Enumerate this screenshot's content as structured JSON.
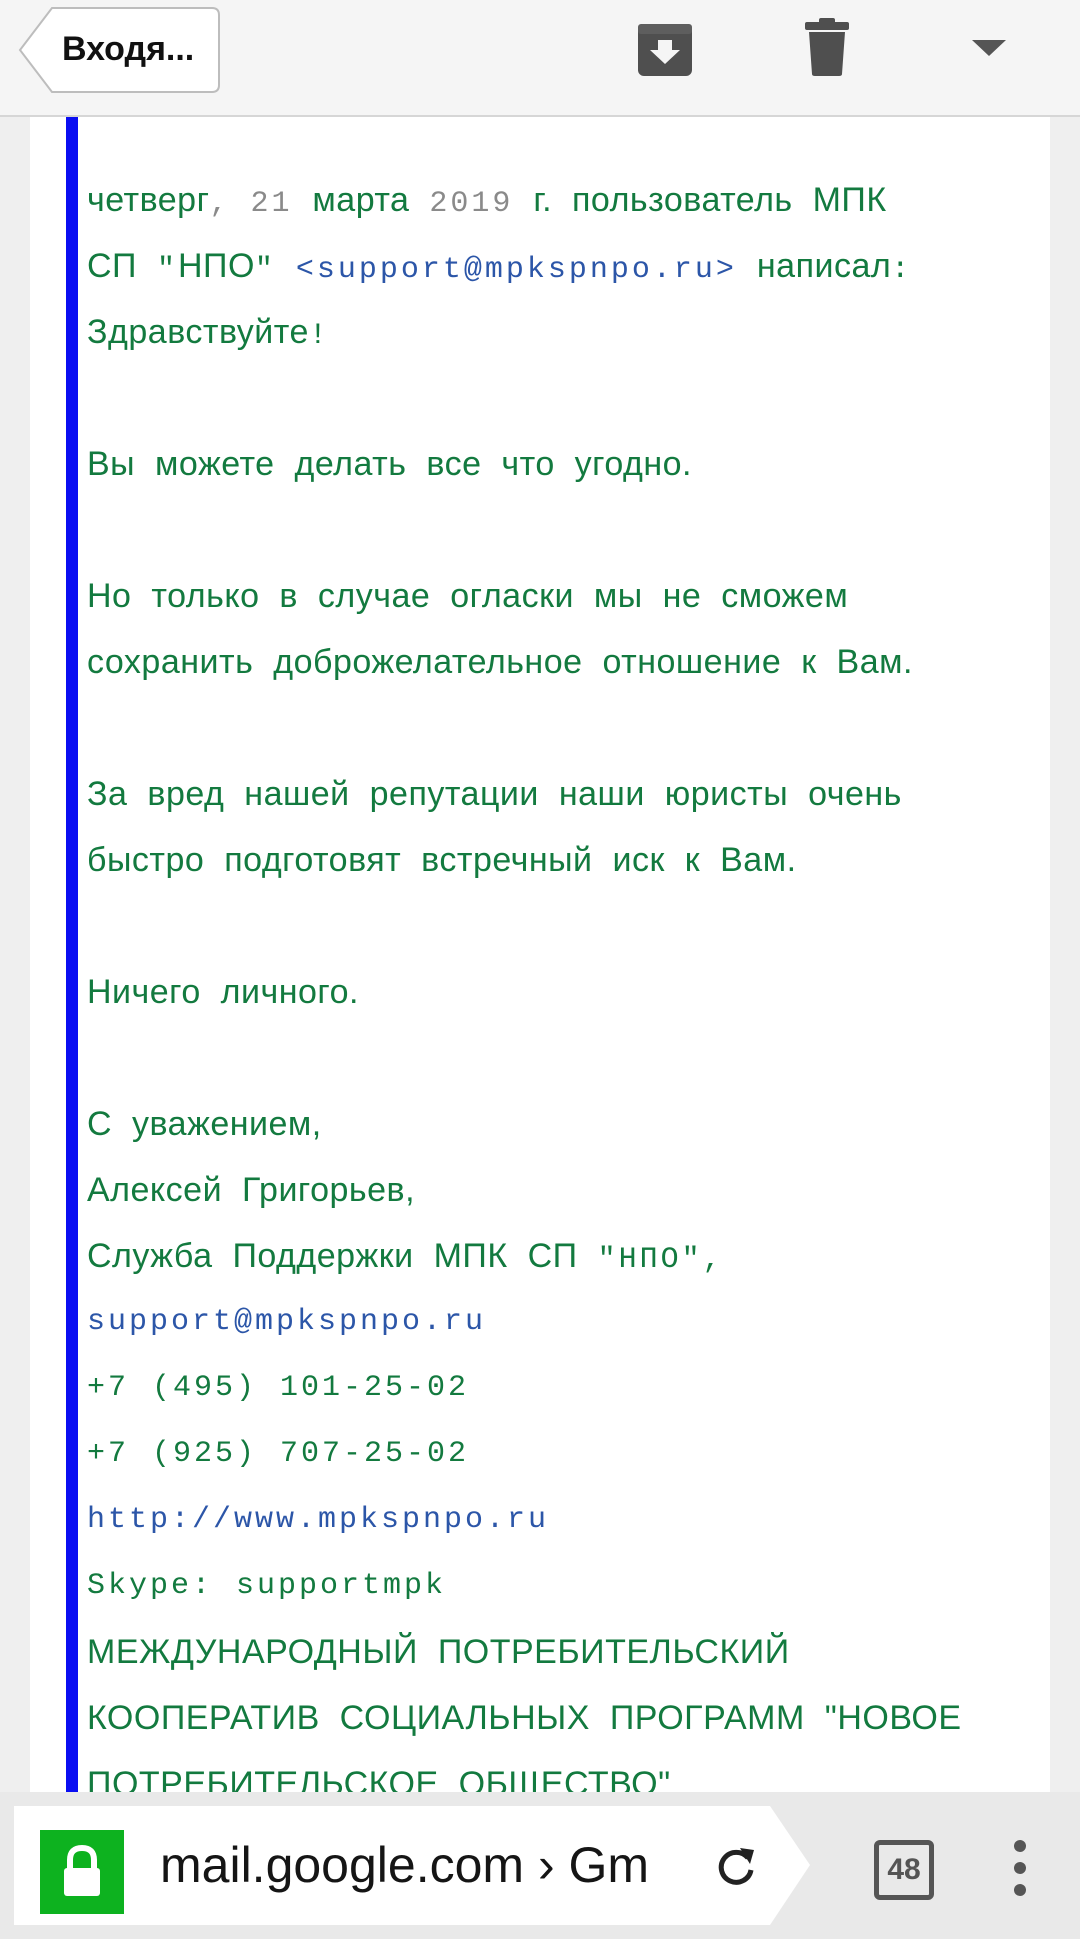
{
  "toolbar": {
    "back_label": "Входя...",
    "icons": [
      "archive-icon",
      "trash-icon",
      "dropdown-icon"
    ]
  },
  "message": {
    "lines": [
      [
        "четверг",
        ", 21 ",
        "марта",
        " 2019 ",
        "г. пользователь МПК"
      ],
      [
        "СП ",
        "\"",
        "НПО",
        "\" <support@mpkspnpo.ru>",
        " написал",
        ":"
      ],
      [
        "Здравствуйте",
        "!"
      ],
      "Вы можете делать все что угодно.",
      "Но только в случае огласки мы не сможем",
      "сохранить доброжелательное отношение к Вам.",
      "За вред нашей репутации наши юристы очень",
      "быстро подготовят встречный иск к Вам.",
      "Ничего личного.",
      "С уважением,",
      "Алексей Григорьев,",
      "Служба Поддержки МПК СП \"НПО\","
    ],
    "header_line1": {
      "weekday": "четверг",
      "comma": ",",
      "day": "21",
      "month": "марта",
      "year": "2019",
      "rest": "г. пользователь МПК"
    },
    "header_line2": {
      "prefix": "СП",
      "quote_open": "\"",
      "org": "НПО",
      "quote_close": "\"",
      "email": "<support@mpkspnpo.ru>",
      "verb": "написал",
      "colon": ":"
    },
    "greeting": "Здравствуйте",
    "greeting_mark": "!",
    "paragraph1": "Вы можете делать все что угодно.",
    "paragraph2_line1": "Но только в случае огласки мы не сможем",
    "paragraph2_line2": "сохранить доброжелательное отношение к Вам.",
    "paragraph3_line1": "За вред нашей репутации наши юристы очень",
    "paragraph3_line2": "быстро подготовят встречный иск к Вам.",
    "paragraph4": "Ничего личного.",
    "regards": "С уважением,",
    "name": "Алексей Григорьев,",
    "dept_prefix": "Служба Поддержки МПК СП",
    "dept_quote": "\"НПО\",",
    "email": "support@mpkspnpo.ru",
    "phone1": "+7 (495) 101-25-02",
    "phone2": "+7 (925) 707-25-02",
    "website": "http://www.mpkspnpo.ru",
    "skype": "Skype: supportmpk",
    "org_line1": "МЕЖДУНАРОДНЫЙ ПОТРЕБИТЕЛЬСКИЙ",
    "org_line2_text": "КООПЕРАТИВ СОЦИАЛЬНЫХ ПРОГРАММ",
    "org_line2_quote": "\"НОВОЕ",
    "org_line3": "ПОТРЕБИТЕЛЬСКОЕ ОБЩЕСТВО\""
  },
  "browser": {
    "url": "mail.google.com › Gm",
    "tab_count": "48",
    "icons": [
      "lock-icon",
      "reload-icon",
      "tabs-icon",
      "overflow-menu-icon"
    ]
  },
  "colors": {
    "text_green": "#137a3f",
    "quote_bar": "#0a0ef2",
    "link_blue": "#2c56a8",
    "lock_green": "#0db21f"
  }
}
